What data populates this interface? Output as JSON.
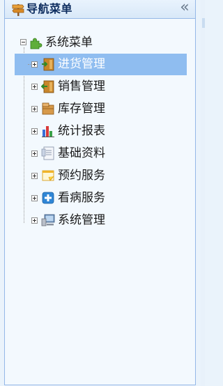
{
  "header": {
    "title": "导航菜单",
    "collapse_glyph": "«"
  },
  "tree": {
    "root": {
      "label": "系统菜单",
      "expanded": true
    },
    "items": [
      {
        "label": "进货管理",
        "icon": "purchase-door-icon",
        "selected": true
      },
      {
        "label": "销售管理",
        "icon": "sales-door-icon",
        "selected": false
      },
      {
        "label": "库存管理",
        "icon": "inventory-box-icon",
        "selected": false
      },
      {
        "label": "统计报表",
        "icon": "bar-chart-icon",
        "selected": false
      },
      {
        "label": "基础资料",
        "icon": "document-icon",
        "selected": false
      },
      {
        "label": "预约服务",
        "icon": "appointment-note-icon",
        "selected": false
      },
      {
        "label": "看病服务",
        "icon": "medical-cross-icon",
        "selected": false
      },
      {
        "label": "系统管理",
        "icon": "computer-icon",
        "selected": false
      }
    ]
  },
  "colors": {
    "selected_bg": "#8fbdf0",
    "panel_border": "#95b8e7",
    "title_text": "#0e2d5f"
  }
}
